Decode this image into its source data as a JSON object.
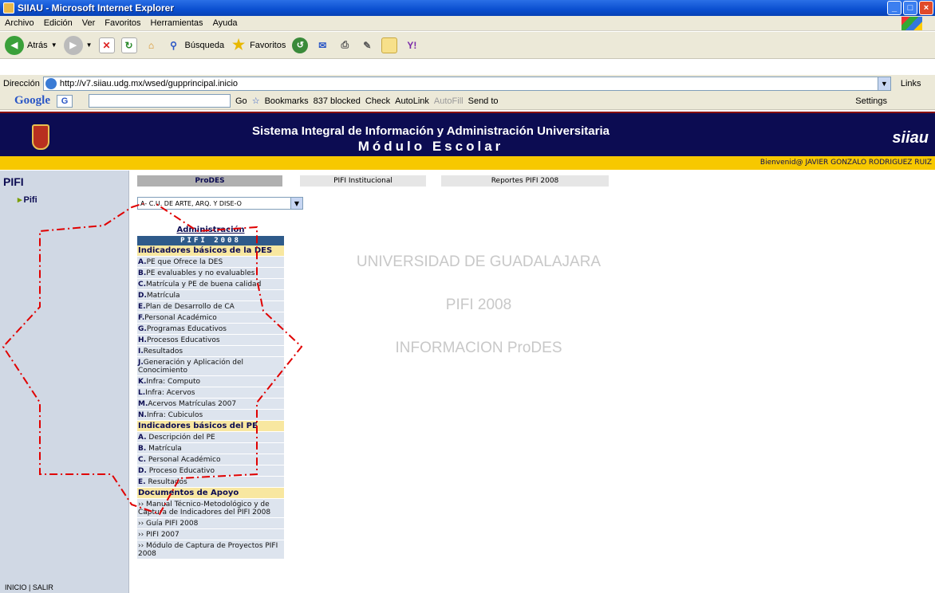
{
  "window": {
    "title": "SIIAU - Microsoft Internet Explorer",
    "buttons": [
      "_",
      "□",
      "×"
    ]
  },
  "menubar": [
    "Archivo",
    "Edición",
    "Ver",
    "Favoritos",
    "Herramientas",
    "Ayuda"
  ],
  "toolbar": {
    "back_label": "Atrás",
    "search_label": "Búsqueda",
    "favorites_label": "Favoritos"
  },
  "address": {
    "label": "Dirección",
    "url": "http://v7.siiau.udg.mx/wsed/gupprincipal.inicio",
    "links_label": "Links"
  },
  "googlebar": {
    "logo": "Google",
    "g_label": "G",
    "go_label": "Go",
    "bookmarks_label": "Bookmarks",
    "blocked_label": "837 blocked",
    "check_label": "Check",
    "autolink_label": "AutoLink",
    "autofill_label": "AutoFill",
    "sendto_label": "Send to",
    "settings_label": "Settings"
  },
  "header": {
    "line1": "Sistema Integral de Información y Administración Universitaria",
    "line2": "Módulo Escolar",
    "logo": "siiau",
    "welcome": "Bienvenid@ JAVIER GONZALO RODRIGUEZ RUIZ"
  },
  "left": {
    "title": "PIFI",
    "item": "Pifi",
    "footer": "INICIO | SALIR"
  },
  "tabs": [
    "ProDES",
    "PIFI Institucional",
    "Reportes PIFI 2008"
  ],
  "select_value": "A- C.U. DE ARTE, ARQ. Y DISE-O",
  "admin_link": "Administración",
  "pifi_band": "PIFI 2008",
  "menu": {
    "sec1": "Indicadores básicos de la DES",
    "items1": [
      {
        "k": "A.",
        "t": "PE que Ofrece la DES"
      },
      {
        "k": "B.",
        "t": "PE evaluables y no evaluables"
      },
      {
        "k": "C.",
        "t": "Matrícula y PE de buena calidad"
      },
      {
        "k": "D.",
        "t": "Matrícula"
      },
      {
        "k": "E.",
        "t": "Plan de Desarrollo de CA"
      },
      {
        "k": "F.",
        "t": "Personal Académico"
      },
      {
        "k": "G.",
        "t": "Programas Educativos"
      },
      {
        "k": "H.",
        "t": "Procesos Educativos"
      },
      {
        "k": "I.",
        "t": "Resultados"
      },
      {
        "k": "J.",
        "t": "Generación y Aplicación del Conocimiento"
      },
      {
        "k": "K.",
        "t": "Infra: Computo"
      },
      {
        "k": "L.",
        "t": "Infra: Acervos"
      },
      {
        "k": "M.",
        "t": "Acervos Matrículas 2007"
      },
      {
        "k": "N.",
        "t": "Infra: Cubiculos"
      }
    ],
    "sec2": "Indicadores básicos del PE",
    "items2": [
      {
        "k": "A.",
        "t": " Descripción del PE"
      },
      {
        "k": "B.",
        "t": " Matrícula"
      },
      {
        "k": "C.",
        "t": " Personal Académico"
      },
      {
        "k": "D.",
        "t": " Proceso Educativo"
      },
      {
        "k": "E.",
        "t": " Resultados"
      }
    ],
    "sec3": "Documentos de Apoyo",
    "items3": [
      "›› Manual Técnico-Metodológico y de Captura de Indicadores del PIFI 2008",
      "›› Guía PIFI 2008",
      "›› PIFI 2007",
      "›› Módulo de Captura de Proyectos PIFI 2008"
    ]
  },
  "center": {
    "line1": "UNIVERSIDAD DE GUADALAJARA",
    "line2": "PIFI 2008",
    "line3": "INFORMACION ProDES"
  },
  "colors": {
    "header_bg": "#0c0c52",
    "welcome_bg": "#f7c800",
    "overlay_dash": "#e00000"
  }
}
